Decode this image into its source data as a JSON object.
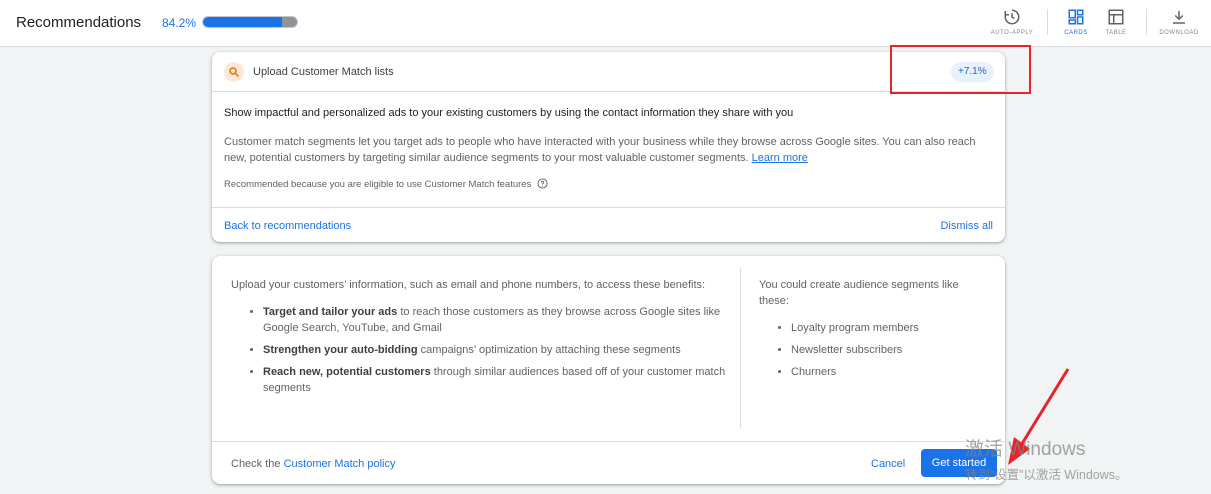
{
  "header": {
    "title": "Recommendations",
    "optimization_score": "84.2%",
    "progress_fraction": 0.842,
    "tools": [
      {
        "label": "AUTO-APPLY",
        "icon": "auto-apply-icon",
        "active": false
      },
      {
        "label": "CARDS",
        "icon": "cards-icon",
        "active": true
      },
      {
        "label": "TABLE",
        "icon": "table-icon",
        "active": false
      },
      {
        "label": "DOWNLOAD",
        "icon": "download-icon",
        "active": false
      }
    ]
  },
  "recommendation": {
    "icon": "search-icon",
    "title": "Upload Customer Match lists",
    "uplift": "+7.1%",
    "headline": "Show impactful and personalized ads to your existing customers by using the contact information they share with you",
    "description": "Customer match segments let you target ads to people who have interacted with your business while they browse across Google sites. You can also reach new, potential customers by targeting similar audience segments to your most valuable customer segments.",
    "learn_more": "Learn more",
    "reason": "Recommended because you are eligible to use Customer Match features",
    "back_link": "Back to recommendations",
    "dismiss_link": "Dismiss all"
  },
  "details": {
    "intro": "Upload your customers’ information, such as email and phone numbers, to access these benefits:",
    "benefits": [
      {
        "bold": "Target and tailor your ads",
        "rest": " to reach those customers as they browse across Google sites like Google Search, YouTube, and Gmail"
      },
      {
        "bold": "Strengthen your auto-bidding",
        "rest": " campaigns’ optimization by attaching these segments"
      },
      {
        "bold": "Reach new, potential customers",
        "rest": " through similar audiences based off of your customer match segments"
      }
    ],
    "segments_intro": "You could create audience segments like these:",
    "segments": [
      "Loyalty program members",
      "Newsletter subscribers",
      "Churners"
    ],
    "policy_prefix": "Check the ",
    "policy_link": "Customer Match policy",
    "cancel_label": "Cancel",
    "primary_label": "Get started"
  },
  "watermark": {
    "line1": "激活 Windows",
    "line2": "转到“设置”以激活 Windows。"
  },
  "colors": {
    "accent": "#1a73e8",
    "annotation": "#e8242b"
  }
}
